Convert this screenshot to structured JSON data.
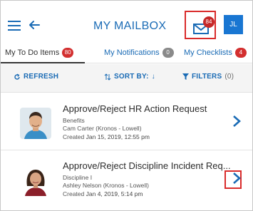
{
  "header": {
    "title": "MY MAILBOX",
    "mail_count": "84",
    "avatar_initials": "JL",
    "accent": "#1a6bb5",
    "highlight": "#d92b2b"
  },
  "tabs": [
    {
      "label": "My To Do Items",
      "badge": "80",
      "badge_color": "red"
    },
    {
      "label": "My Notifications",
      "badge": "0",
      "badge_color": "gray"
    },
    {
      "label": "My Checklists",
      "badge": "4",
      "badge_color": "red"
    }
  ],
  "toolbar": {
    "refresh": "REFRESH",
    "sort": "SORT BY:",
    "sort_arrow": "↓",
    "filters": "FILTERS",
    "filters_count": "(0)"
  },
  "items": [
    {
      "title": "Approve/Reject HR Action Request",
      "category": "Benefits",
      "person": "Cam Carter (Kronos - Lowell)",
      "created_label": "Created",
      "created_date": "Jan 15, 2019, 12:55 pm"
    },
    {
      "title": "Approve/Reject Discipline Incident Req...",
      "category": "Discipline I",
      "person": "Ashley Nelson (Kronos - Lowell)",
      "created_label": "Created",
      "created_date": "Jan 4, 2019, 5:14 pm"
    }
  ]
}
